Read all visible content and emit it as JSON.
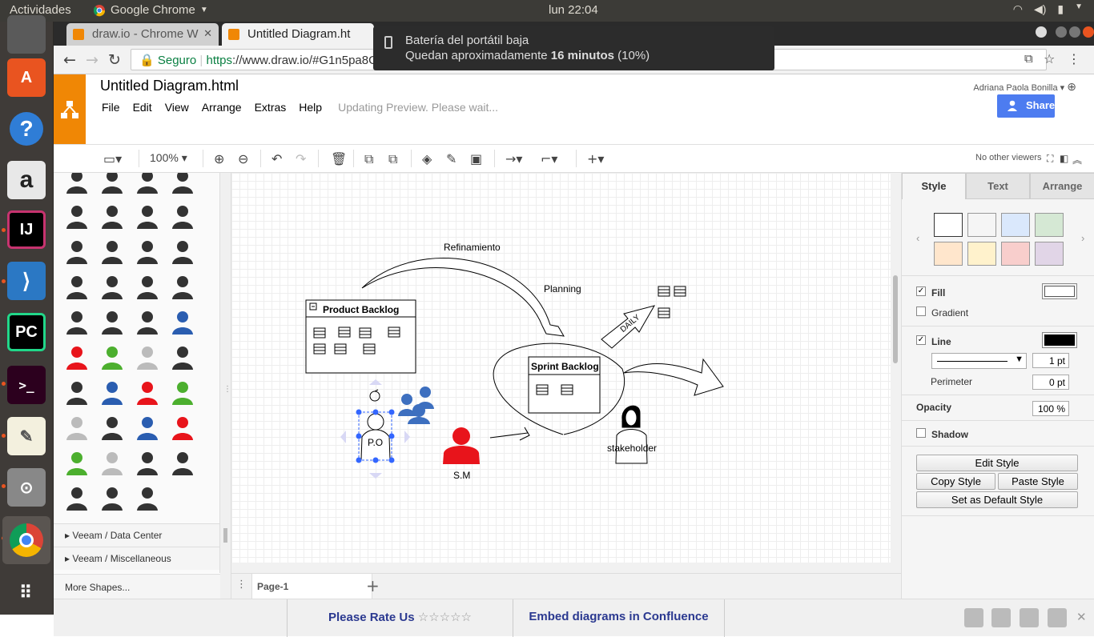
{
  "system": {
    "activities": "Actividades",
    "app_name": "Google Chrome",
    "clock": "lun 22:04"
  },
  "browser": {
    "tabs": [
      {
        "title": "draw.io - Chrome W"
      },
      {
        "title": "Untitled Diagram.ht"
      }
    ],
    "omnibox": {
      "secure_label": "Seguro",
      "url_scheme": "https",
      "url_rest": "://www.draw.io/#G1n5pa8Ga"
    }
  },
  "notification": {
    "title": "Batería del portátil baja",
    "body_prefix": "Quedan aproximadamente ",
    "body_bold": "16 minutos",
    "body_suffix": " (10%)"
  },
  "app": {
    "title": "Untitled Diagram.html",
    "menu": [
      "File",
      "Edit",
      "View",
      "Arrange",
      "Extras",
      "Help"
    ],
    "status": "Updating Preview. Please wait...",
    "user": "Adriana Paola Bonilla",
    "share": "Share",
    "zoom": "100%",
    "viewers": "No other viewers"
  },
  "sidebar": {
    "libraries": [
      "Veeam / Data Center",
      "Veeam / Miscellaneous"
    ],
    "more_shapes": "More Shapes..."
  },
  "diagram": {
    "product_backlog": "Product Backlog",
    "sprint_backlog": "Sprint Backlog",
    "refinamiento": "Refinamiento",
    "planning": "Planning",
    "daily": "DAILY",
    "po": "P.O",
    "sm": "S.M",
    "stakeholder": "stakeholder"
  },
  "pages": {
    "current": "Page-1"
  },
  "panel": {
    "tabs": [
      "Style",
      "Text",
      "Arrange"
    ],
    "swatches": [
      "#ffffff",
      "#f5f5f5",
      "#dae8fc",
      "#d5e8d4",
      "#ffe6cc",
      "#fff2cc",
      "#f8cecc",
      "#e1d5e7"
    ],
    "fill": "Fill",
    "gradient": "Gradient",
    "line": "Line",
    "line_width": "1 pt",
    "perimeter": "Perimeter",
    "perimeter_value": "0 pt",
    "opacity": "Opacity",
    "opacity_value": "100 %",
    "shadow": "Shadow",
    "edit_style": "Edit Style",
    "copy_style": "Copy Style",
    "paste_style": "Paste Style",
    "default_style": "Set as Default Style"
  },
  "footer": {
    "rate": "Please Rate Us",
    "stars": "☆☆☆☆☆",
    "embed": "Embed diagrams in Confluence"
  }
}
